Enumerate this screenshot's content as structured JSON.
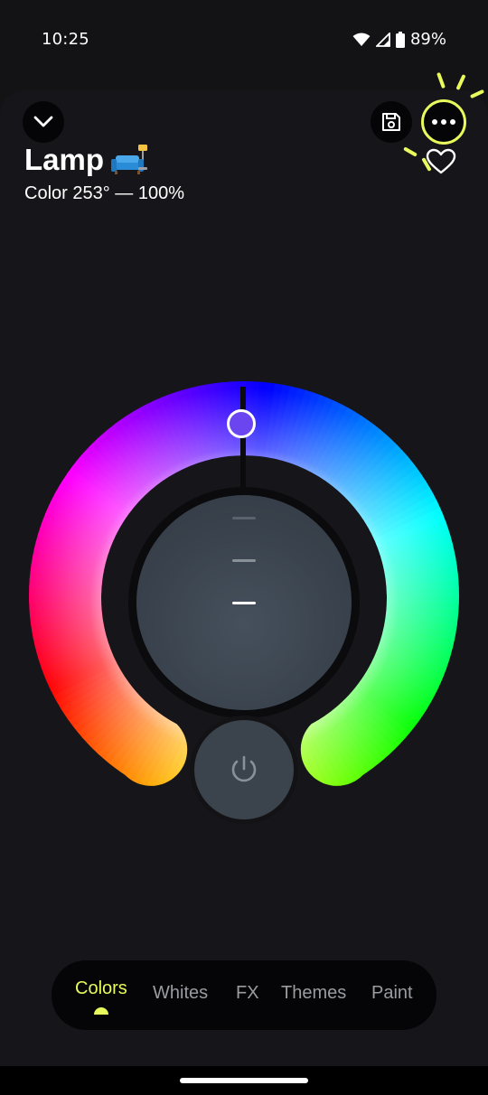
{
  "status_bar": {
    "time": "10:25",
    "battery": "89%",
    "icons": [
      "wifi-icon",
      "signal-icon",
      "battery-icon"
    ]
  },
  "header": {
    "title": "Lamp",
    "title_emoji": "🛋️",
    "subtitle": "Color 253° — 100%",
    "collapse_icon": "chevron-down-icon",
    "save_icon": "save-icon",
    "more_icon": "more-horizontal-icon",
    "favorite_icon": "heart-outline-icon"
  },
  "color_control": {
    "hue": 253,
    "brightness_percent": 100,
    "selected_color": "#6b45f0",
    "brightness_levels": 3,
    "active_brightness_level": 3,
    "power_icon": "power-icon"
  },
  "tabs": [
    {
      "label": "Colors",
      "active": true
    },
    {
      "label": "Whites",
      "active": false
    },
    {
      "label": "FX",
      "active": false
    },
    {
      "label": "Themes",
      "active": false
    },
    {
      "label": "Paint",
      "active": false
    }
  ],
  "colors": {
    "accent": "#e8fa5c",
    "background": "#131316",
    "control": "#3b434c"
  }
}
